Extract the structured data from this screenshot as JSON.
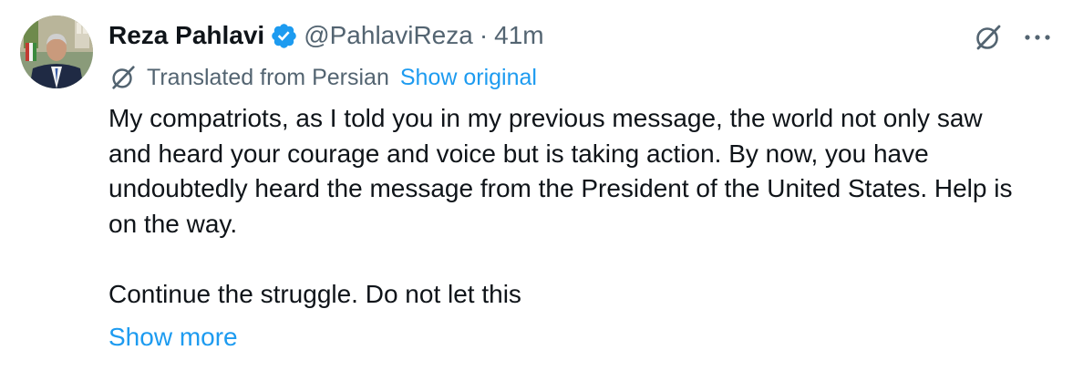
{
  "author": {
    "display_name": "Reza Pahlavi",
    "handle": "@PahlaviReza",
    "separator": "·",
    "timestamp": "41m",
    "verified": true,
    "verified_color": "#1d9bf0"
  },
  "actions": {
    "grok_icon": "grok-slash-circle-icon",
    "more_icon": "more-horizontal-icon"
  },
  "translation": {
    "label": "Translated from Persian",
    "show_original": "Show original"
  },
  "body": {
    "paragraphs": [
      "My compatriots, as I told you in my previous message, the world not only saw and heard your courage and voice but is taking action. By now, you have undoubtedly heard the message from the President of the United States. Help is on the way.",
      "Continue the struggle. Do not let this"
    ],
    "show_more": "Show more"
  },
  "colors": {
    "text": "#0f1419",
    "secondary": "#536471",
    "link": "#1d9bf0"
  }
}
